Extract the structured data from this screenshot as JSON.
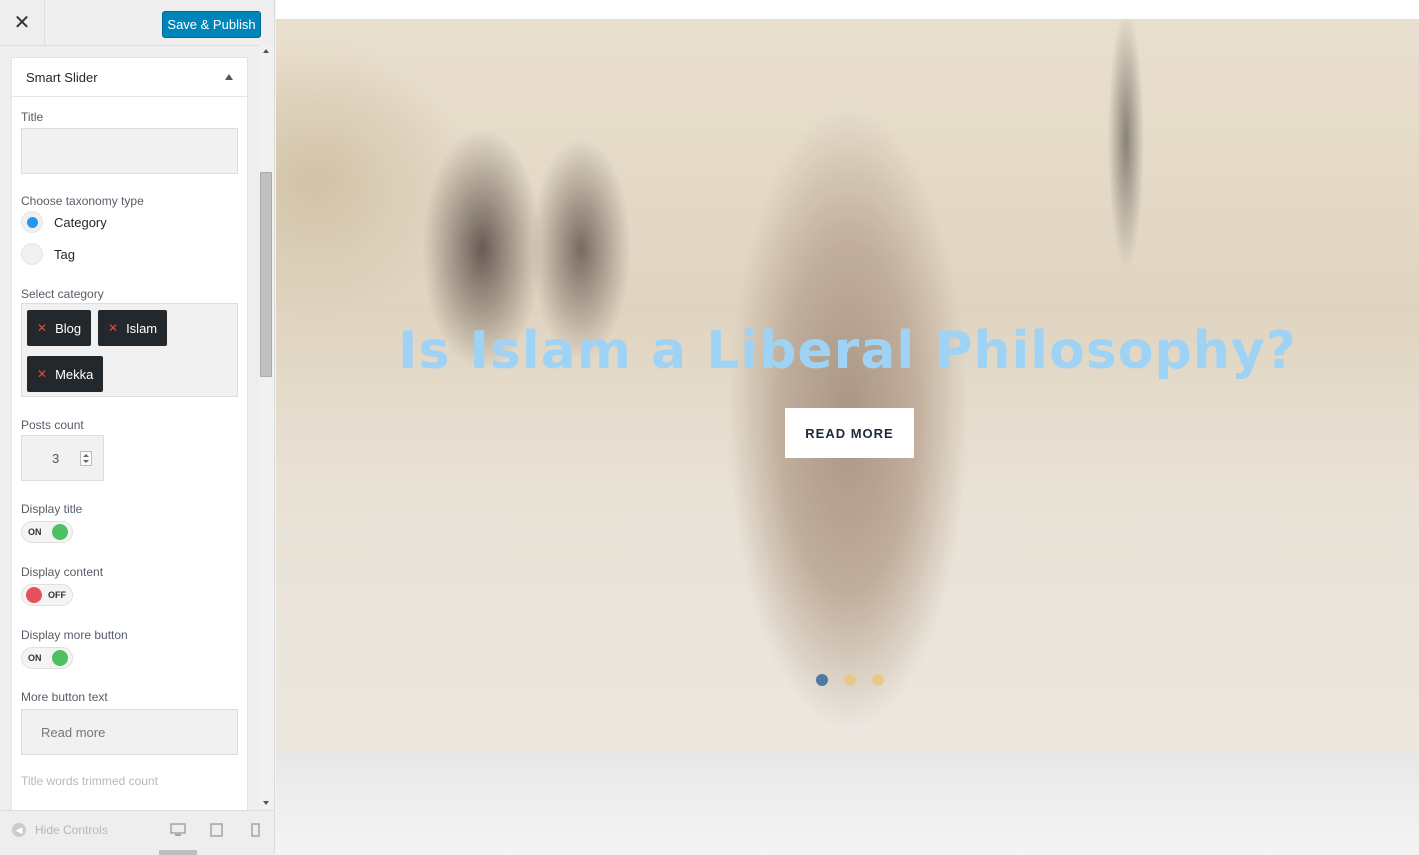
{
  "header": {
    "close_label": "✕",
    "publish_label": "Save & Publish"
  },
  "panel": {
    "title": "Smart Slider",
    "title_label": "Title",
    "title_value": "",
    "taxonomy_label": "Choose taxonomy type",
    "taxonomy_options": [
      "Category",
      "Tag"
    ],
    "taxonomy_selected": "Category",
    "category_label": "Select category",
    "categories": [
      "Blog",
      "Islam",
      "Mekka"
    ],
    "posts_count_label": "Posts count",
    "posts_count": "3",
    "display_title_label": "Display title",
    "display_title": "ON",
    "display_content_label": "Display content",
    "display_content": "OFF",
    "display_more_label": "Display more button",
    "display_more": "ON",
    "more_text_label": "More button text",
    "more_text_value": "Read more",
    "trimmed_label": "Title words trimmed count"
  },
  "footer": {
    "hide_controls": "Hide Controls"
  },
  "preview": {
    "slide_title": "Is Islam a Liberal Philosophy?",
    "button_label": "READ MORE",
    "slide_count": 3,
    "active_slide": 1
  },
  "colors": {
    "accent": "#0085ba",
    "toggle_on": "#4cc063",
    "toggle_off": "#e8515b",
    "title": "#9fd3f5"
  }
}
